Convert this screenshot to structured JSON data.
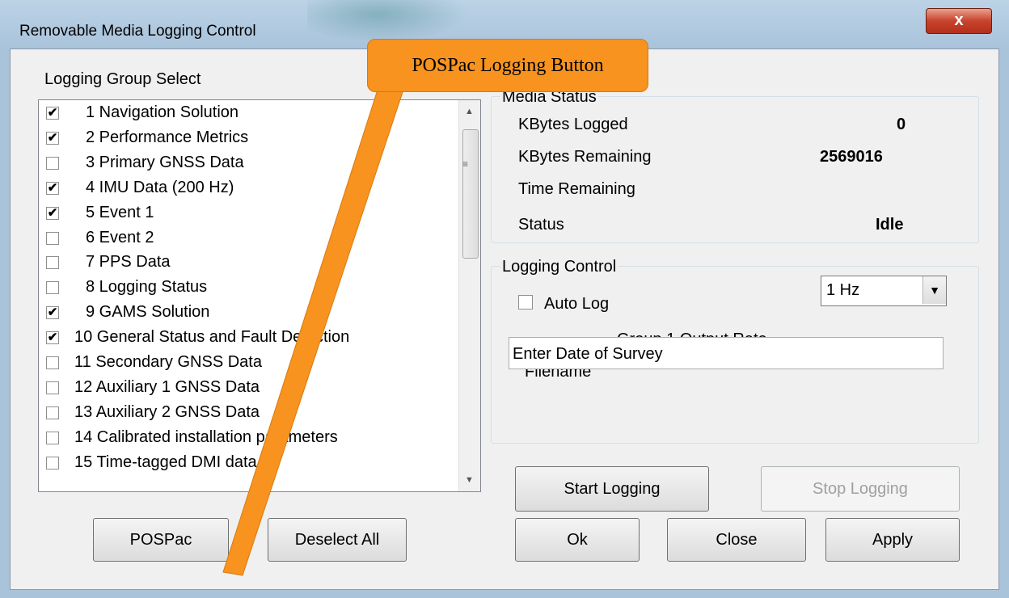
{
  "window": {
    "title": "Removable Media Logging Control",
    "close_glyph": "x"
  },
  "callout": {
    "text": "POSPac Logging Button",
    "color": "#f7931e"
  },
  "logging_group": {
    "heading": "Logging Group Select",
    "items": [
      {
        "label": "1 Navigation Solution",
        "checked": true
      },
      {
        "label": "2 Performance Metrics",
        "checked": true
      },
      {
        "label": "3 Primary GNSS Data",
        "checked": false
      },
      {
        "label": "4 IMU Data (200 Hz)",
        "checked": true
      },
      {
        "label": "5 Event 1",
        "checked": true
      },
      {
        "label": "6 Event 2",
        "checked": false
      },
      {
        "label": "7 PPS Data",
        "checked": false
      },
      {
        "label": "8 Logging Status",
        "checked": false
      },
      {
        "label": "9 GAMS Solution",
        "checked": true
      },
      {
        "label": "10 General Status and Fault Detection",
        "checked": true
      },
      {
        "label": "11 Secondary GNSS Data",
        "checked": false
      },
      {
        "label": "12 Auxiliary 1 GNSS Data",
        "checked": false
      },
      {
        "label": "13 Auxiliary 2 GNSS Data",
        "checked": false
      },
      {
        "label": "14 Calibrated installation parameters",
        "checked": false
      },
      {
        "label": "15 Time-tagged DMI data",
        "checked": false
      }
    ],
    "pospac_button": "POSPac",
    "deselect_all_button": "Deselect All"
  },
  "media_status": {
    "legend": "Media Status",
    "kbytes_logged_label": "KBytes Logged",
    "kbytes_logged_value": "0",
    "kbytes_remaining_label": "KBytes Remaining",
    "kbytes_remaining_value": "2569016",
    "time_remaining_label": "Time Remaining",
    "status_label": "Status",
    "status_value": "Idle"
  },
  "logging_control": {
    "legend": "Logging Control",
    "auto_log_label": "Auto Log",
    "auto_log_checked": false,
    "output_rate_label": "Group 1 Output Rate",
    "output_rate_value": "1 Hz",
    "filename_label": "Filename",
    "filename_value": "Enter Date of Survey",
    "start_button": "Start Logging",
    "stop_button": "Stop Logging"
  },
  "footer": {
    "ok": "Ok",
    "close": "Close",
    "apply": "Apply"
  }
}
